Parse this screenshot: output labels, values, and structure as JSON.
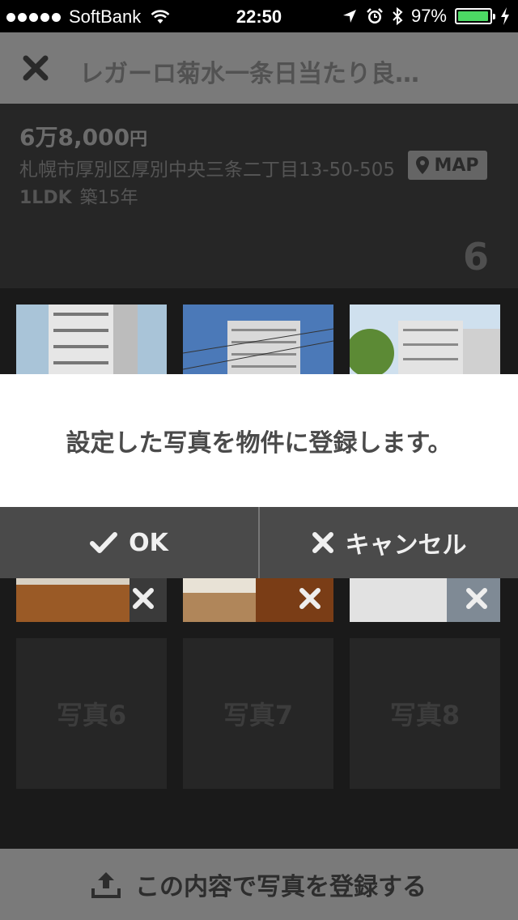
{
  "status_bar": {
    "carrier": "SoftBank",
    "time": "22:50",
    "battery": "97%",
    "battery_level": 0.97,
    "signal_bars": 5
  },
  "nav": {
    "title": "レガーロ菊水一条日当たり良…"
  },
  "property": {
    "price": "6万8,000",
    "price_unit": "円",
    "address": "札幌市厚別区厚別中央三条二丁目13-50-505",
    "map_label": "MAP",
    "layout": "1LDK",
    "age": "築15年",
    "photo_count": "6"
  },
  "dialog": {
    "message": "設定した写真を物件に登録します。",
    "ok_label": "OK",
    "cancel_label": "キャンセル"
  },
  "photo_slots": [
    {
      "label": "写真6"
    },
    {
      "label": "写真7"
    },
    {
      "label": "写真8"
    }
  ],
  "bottom": {
    "register_label": "この内容で写真を登録する"
  },
  "colors": {
    "accent_battery": "#4cd964",
    "nav_bg": "#7a7a7a",
    "dialog_bg": "#ffffff",
    "button_bar_bg": "#4a4a4a"
  }
}
